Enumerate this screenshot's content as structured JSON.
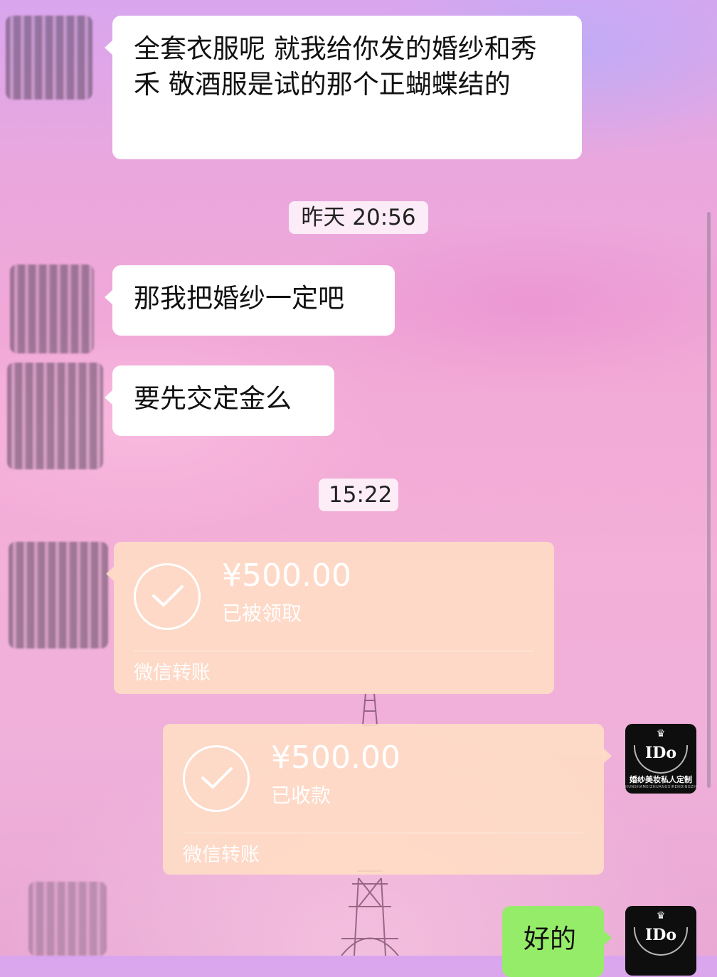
{
  "messages": {
    "m1": "全套衣服呢 就我给你发的婚纱和秀禾 敬酒服是试的那个正蝴蝶结的",
    "ts1": "昨天 20:56",
    "m2": "那我把婚纱一定吧",
    "m3": "要先交定金么",
    "ts2": "15:22",
    "t1": {
      "amount": "¥500.00",
      "status": "已被领取",
      "footer": "微信转账"
    },
    "t2": {
      "amount": "¥500.00",
      "status": "已收款",
      "footer": "微信转账"
    },
    "m4": "好的"
  },
  "brand_avatar": {
    "logo": "IDo",
    "tagline": "婚纱美妆私人定制",
    "tagline_sub": "HUNSHAMEIZHUANGSIRENDINGZHI"
  },
  "colors": {
    "chat_bg": "#f2a9d6",
    "bubble_white": "#ffffff",
    "bubble_green": "#95ec69",
    "transfer_card": "#ffdec4"
  }
}
